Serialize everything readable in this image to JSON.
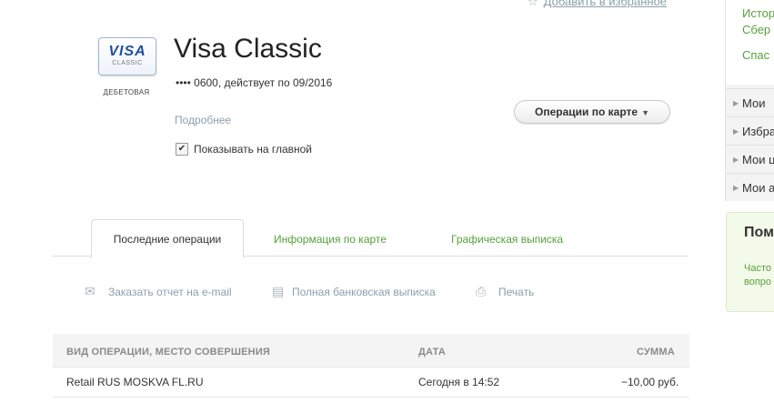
{
  "header": {
    "favorite_link": "Добавить в избранное"
  },
  "card": {
    "logo_brand": "VISA",
    "logo_sub": "CLASSIC",
    "type_label": "ДЕБЕТОВАЯ",
    "title": "Visa Classic",
    "info": "•••• 0600, действует по 09/2016",
    "details_link": "Подробнее",
    "show_on_main_label": "Показывать на главной",
    "show_on_main_checked": true,
    "operations_button": "Операции по карте"
  },
  "tabs": [
    {
      "label": "Последние операции",
      "active": true
    },
    {
      "label": "Информация по карте",
      "active": false
    },
    {
      "label": "Графическая выписка",
      "active": false
    }
  ],
  "actions": {
    "email_report": "Заказать отчет на e-mail",
    "full_statement": "Полная банковская выписка",
    "print": "Печать"
  },
  "table": {
    "columns": [
      "ВИД ОПЕРАЦИИ, МЕСТО СОВЕРШЕНИЯ",
      "ДАТА",
      "СУММА"
    ],
    "rows": [
      {
        "operation": "Retail RUS MOSKVA FL.RU",
        "date": "Сегодня в 14:52",
        "amount": "−10,00 руб."
      }
    ]
  },
  "sidebar": {
    "links": [
      "Истор",
      "Сбер",
      "Спас"
    ],
    "items": [
      "Мои",
      "Избра",
      "Мои ц",
      "Мои а"
    ]
  },
  "help": {
    "title": "Пом",
    "lines": [
      "Часто",
      "вопро"
    ]
  },
  "colors": {
    "link_green": "#58a13b",
    "link_gray": "#8aa0ad",
    "visa_blue": "#1f4f9f"
  }
}
